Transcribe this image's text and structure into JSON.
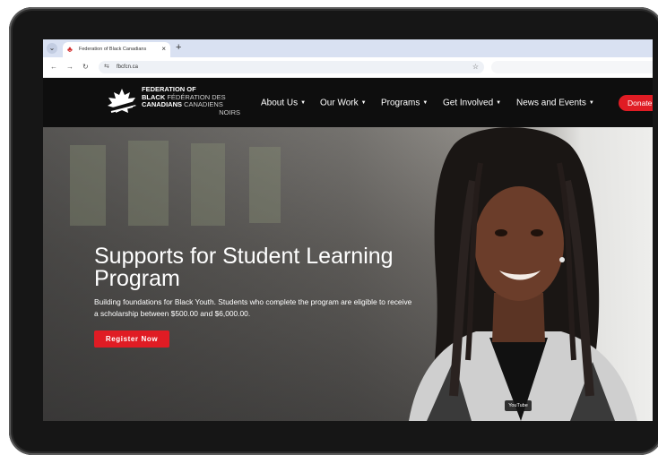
{
  "browser": {
    "tab_title": "Federation of Black Canadians",
    "tab_close": "×",
    "new_tab": "+",
    "url": "fbcfcn.ca",
    "icons": {
      "tab_menu": "chevron-down-icon",
      "favicon": "maple-leaf-icon",
      "back": "back-arrow-icon",
      "forward": "forward-arrow-icon",
      "reload": "reload-icon",
      "site_info": "site-info-icon",
      "bookmark": "star-icon"
    }
  },
  "header": {
    "logo": {
      "en_line1": "FEDERATION OF",
      "en_line2": "BLACK",
      "fr_line2": "FÉDÉRATION DES",
      "en_line3": "CANADIANS",
      "fr_line3": "CANADIENS",
      "fr_line4": "NOIRS"
    },
    "nav": [
      {
        "label": "About Us"
      },
      {
        "label": "Our Work"
      },
      {
        "label": "Programs"
      },
      {
        "label": "Get Involved"
      },
      {
        "label": "News and Events"
      }
    ],
    "donate_label": "Donate"
  },
  "hero": {
    "title": "Supports for Student Learning Program",
    "subtitle": "Building foundations for Black Youth. Students who complete the program are eligible to receive a scholarship between $500.00 and $6,000.00.",
    "cta_label": "Register Now",
    "video_label": "YouTube"
  },
  "colors": {
    "accent": "#e01c24",
    "header_bg": "#0e0e0e",
    "tabbar_bg": "#d9e1f2"
  }
}
